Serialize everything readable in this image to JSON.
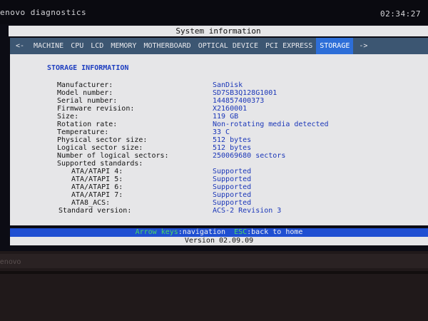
{
  "app": {
    "title": "enovo diagnostics",
    "time": "02:34:27"
  },
  "section_title": "System information",
  "tabs": [
    {
      "label": "<-",
      "active": false
    },
    {
      "label": "MACHINE",
      "active": false
    },
    {
      "label": "CPU",
      "active": false
    },
    {
      "label": "LCD",
      "active": false
    },
    {
      "label": "MEMORY",
      "active": false
    },
    {
      "label": "MOTHERBOARD",
      "active": false
    },
    {
      "label": "OPTICAL DEVICE",
      "active": false
    },
    {
      "label": "PCI EXPRESS",
      "active": false
    },
    {
      "label": "STORAGE",
      "active": true
    },
    {
      "label": "->",
      "active": false
    }
  ],
  "storage": {
    "heading": "STORAGE INFORMATION",
    "rows": [
      {
        "label": "Manufacturer:",
        "value": "SanDisk"
      },
      {
        "label": "Model number:",
        "value": "SD7SB3Q128G1001"
      },
      {
        "label": "Serial number:",
        "value": "144857400373"
      },
      {
        "label": "Firmware revision:",
        "value": "X2160001"
      },
      {
        "label": "Size:",
        "value": "119 GB"
      },
      {
        "label": "Rotation rate:",
        "value": "Non-rotating media detected"
      },
      {
        "label": "Temperature:",
        "value": "33 C"
      },
      {
        "label": "Physical sector size:",
        "value": "512 bytes"
      },
      {
        "label": "Logical sector size:",
        "value": "512 bytes"
      },
      {
        "label": "Number of logical sectors:",
        "value": "250069680 sectors"
      },
      {
        "label": "Supported standards:",
        "value": ""
      },
      {
        "label": "ATA/ATAPI 4:",
        "value": "Supported"
      },
      {
        "label": "ATA/ATAPI 5:",
        "value": "Supported"
      },
      {
        "label": "ATA/ATAPI 6:",
        "value": "Supported"
      },
      {
        "label": "ATA/ATAPI 7:",
        "value": "Supported"
      },
      {
        "label": "ATA8_ACS:",
        "value": "Supported"
      },
      {
        "label": "Standard version:",
        "value": "ACS-2 Revision 3"
      }
    ]
  },
  "status_bar": {
    "nav_key": "Arrow keys",
    "nav_desc": ":navigation",
    "esc_key": "ESC",
    "esc_desc": ":back to home"
  },
  "version": "Version 02.09.09",
  "bezel_logo": "enovo",
  "colors": {
    "panel_bg": "#e6e6e8",
    "tab_bar": "#3c5672",
    "tab_active": "#2d6ed8",
    "value_text": "#1a36b8",
    "heading_text": "#1f3fc0",
    "status_bar": "#1f4fd2",
    "key_text": "#4cd964"
  }
}
